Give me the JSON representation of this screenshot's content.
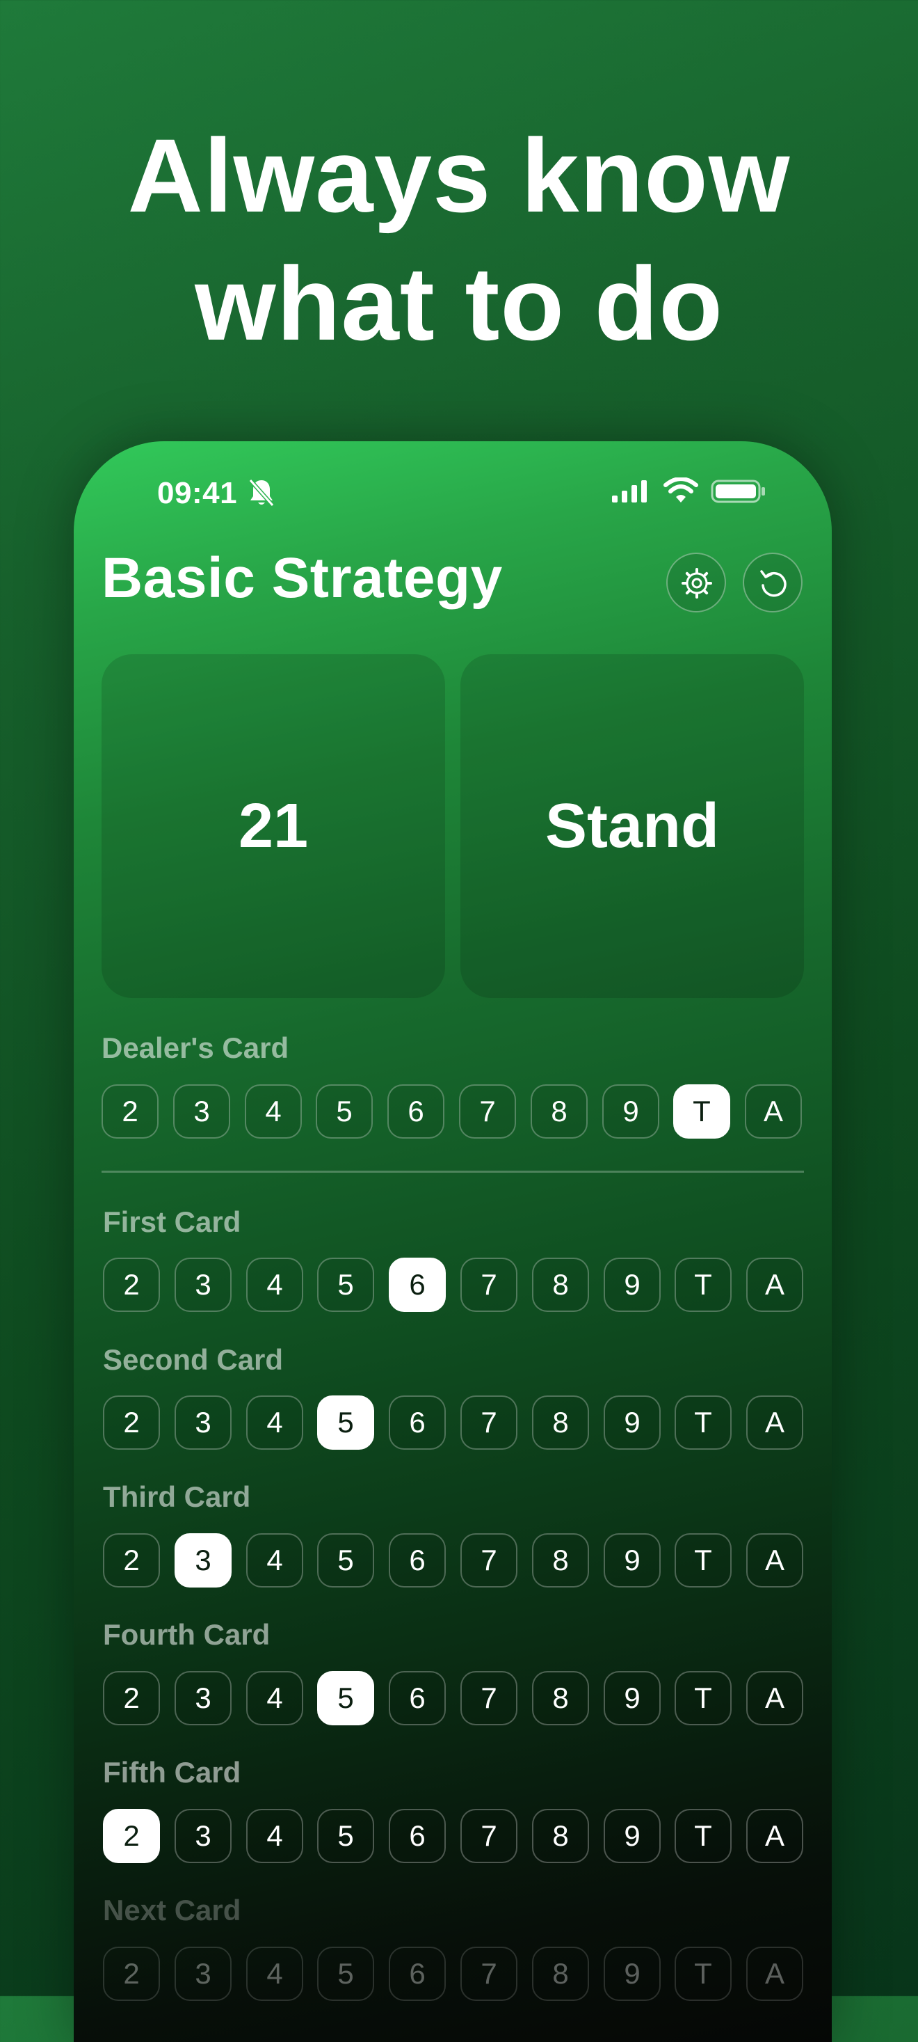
{
  "headline": {
    "line1": "Always know",
    "line2": "what to do"
  },
  "status_bar": {
    "time": "09:41",
    "icons": [
      "bell-slash-icon",
      "signal-icon",
      "wifi-icon",
      "battery-icon"
    ]
  },
  "header": {
    "title": "Basic Strategy",
    "settings_icon": "gear-icon",
    "reset_icon": "reset-icon"
  },
  "result": {
    "total": "21",
    "action": "Stand"
  },
  "card_values": [
    "2",
    "3",
    "4",
    "5",
    "6",
    "7",
    "8",
    "9",
    "T",
    "A"
  ],
  "sections": [
    {
      "label": "Dealer's Card",
      "selected": "T"
    },
    {
      "label": "First Card",
      "selected": "6"
    },
    {
      "label": "Second Card",
      "selected": "5"
    },
    {
      "label": "Third Card",
      "selected": "3"
    },
    {
      "label": "Fourth Card",
      "selected": "5"
    },
    {
      "label": "Fifth Card",
      "selected": "2"
    },
    {
      "label": "Next Card",
      "selected": null
    }
  ],
  "colors": {
    "accent_green": "#32c95a",
    "selected_bg": "#ffffff"
  }
}
